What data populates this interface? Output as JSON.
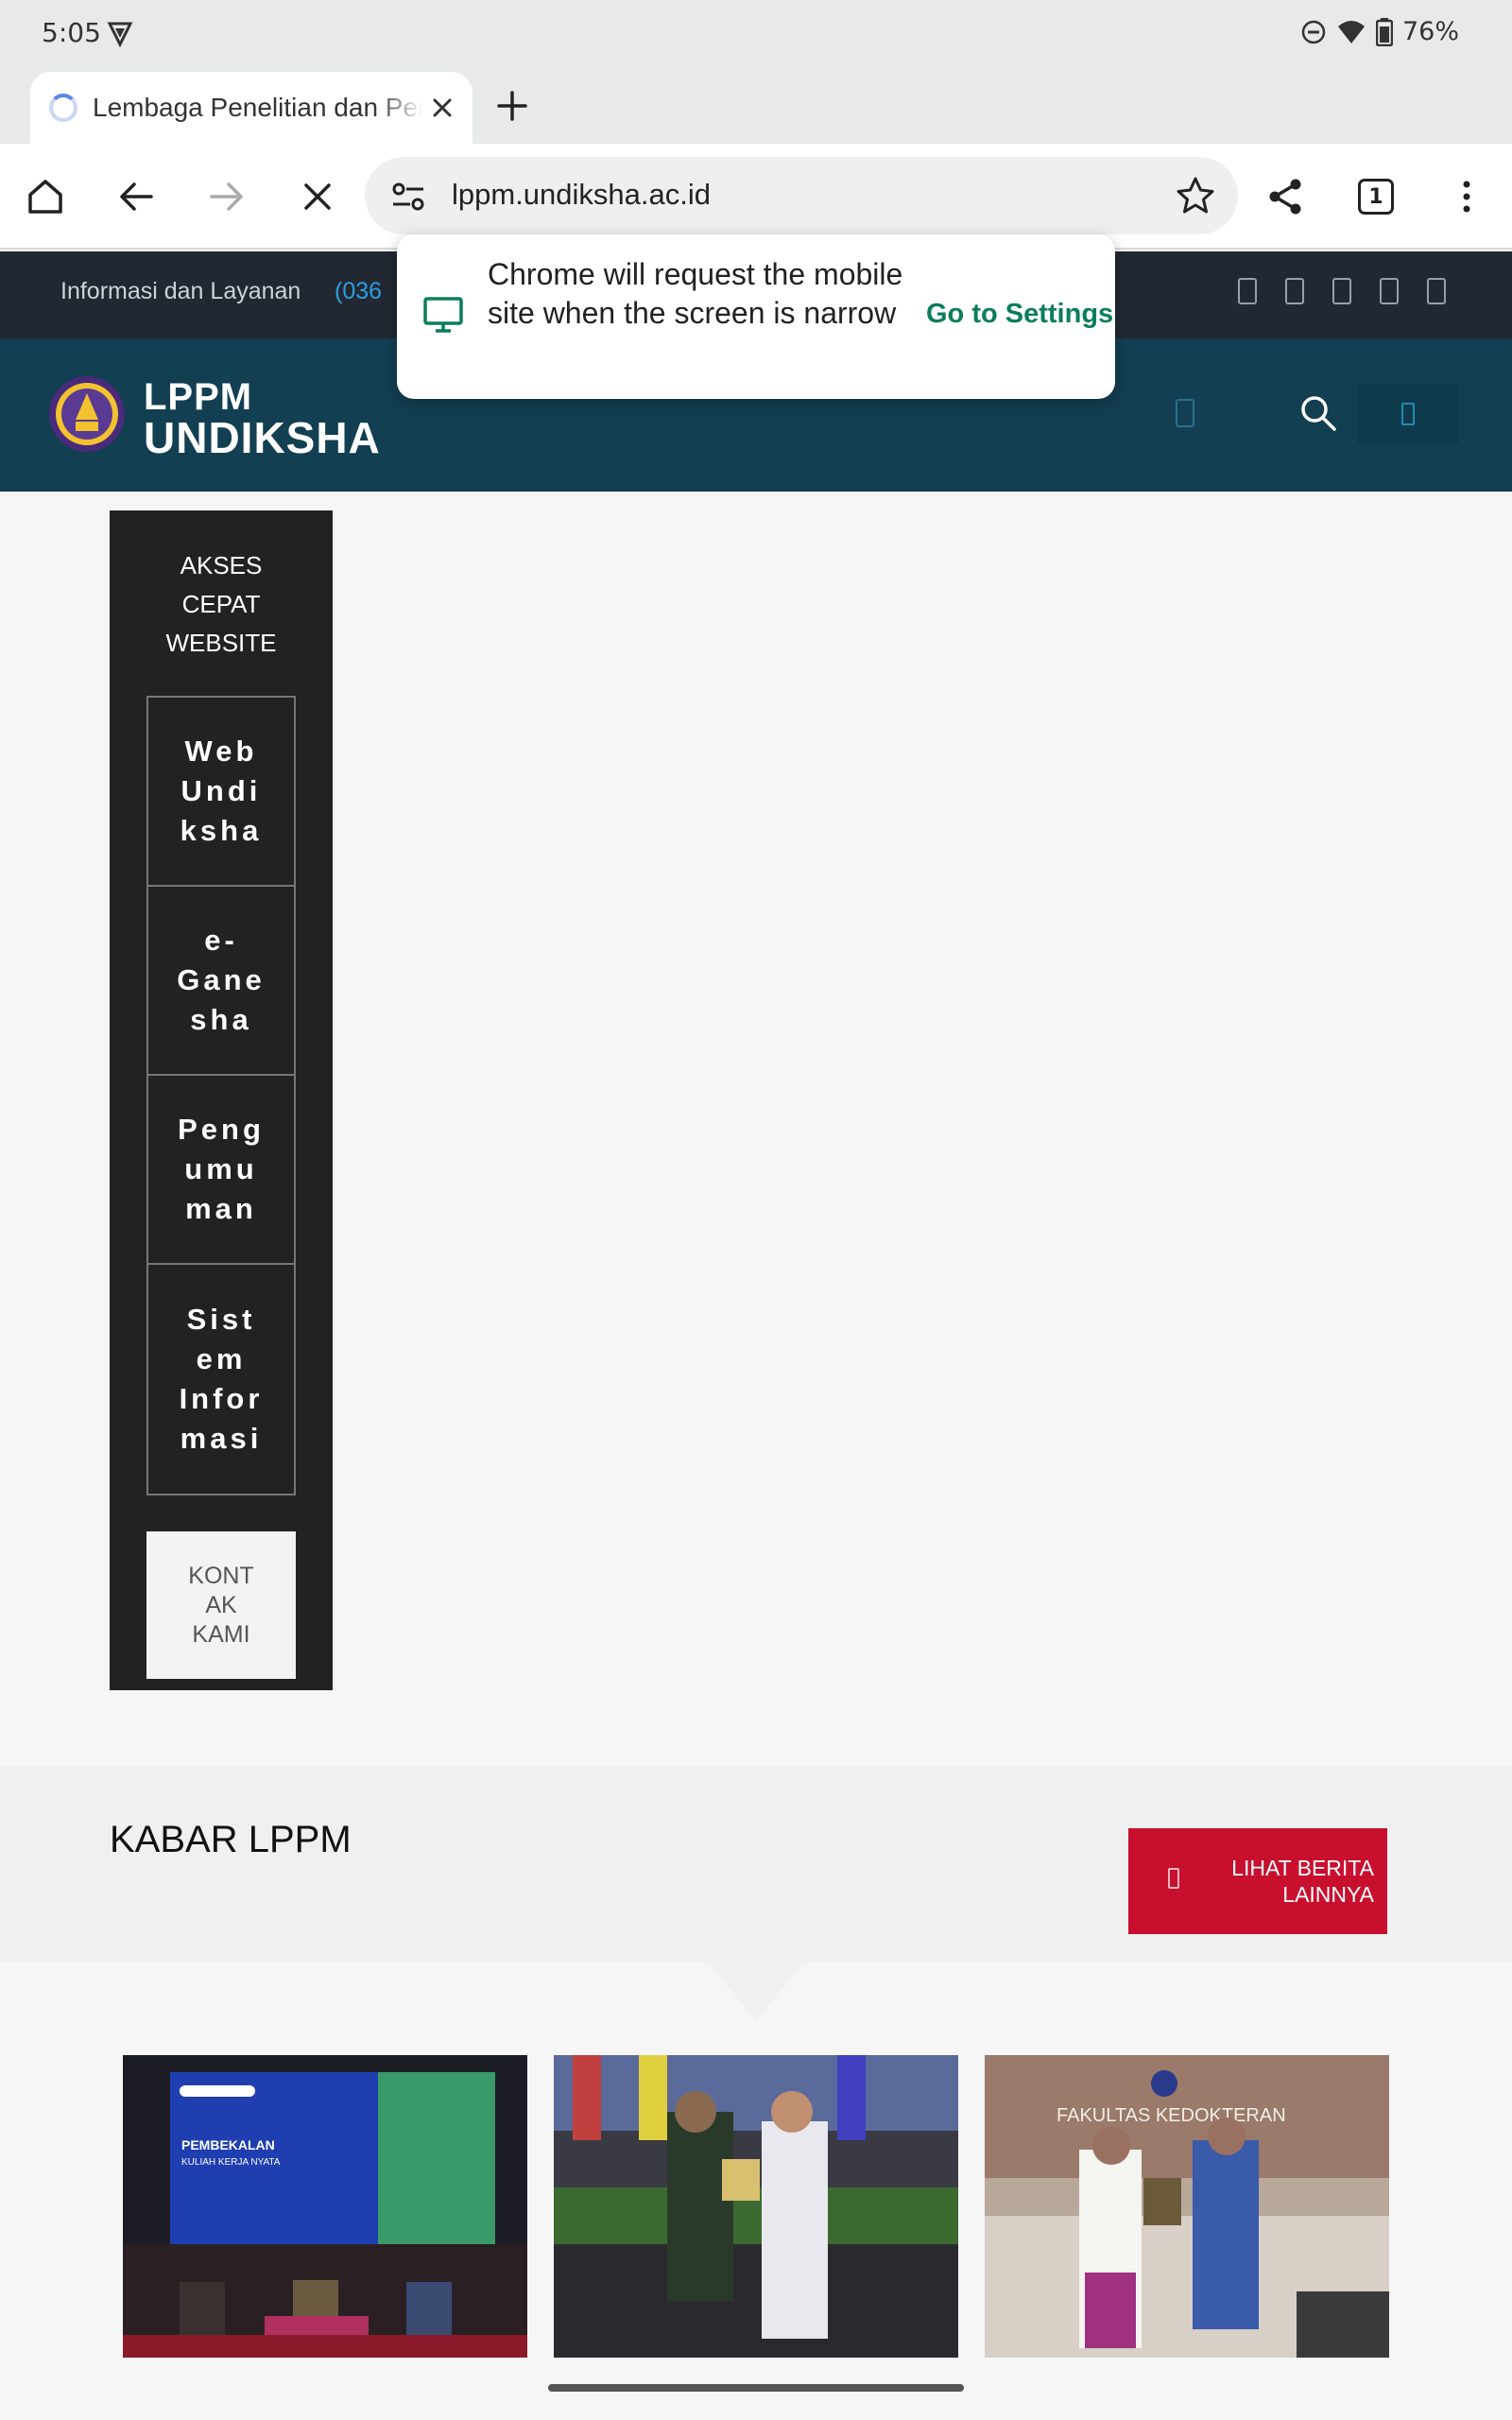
{
  "status_bar": {
    "time": "5:05",
    "battery": "76%"
  },
  "browser": {
    "tab_title": "Lembaga Penelitian dan Pengabdian kepada Masyarakat",
    "tab_count": "1",
    "url": "lppm.undiksha.ac.id"
  },
  "popup": {
    "message": "Chrome will request the mobile site when the screen is narrow",
    "action": "Go to Settings"
  },
  "site": {
    "info_text": "Informasi dan Layanan",
    "info_phone": "(036",
    "logo_line1": "LPPM",
    "logo_line2": "UNDIKSHA"
  },
  "quick_access": {
    "title": "AKSES\nCEPAT\nWEBSITE",
    "items": [
      {
        "label": "Web\nUndi\nksha"
      },
      {
        "label": "e-\nGane\nsha"
      },
      {
        "label": "Peng\numu\nman"
      },
      {
        "label": "Sist\nem\nInfor\nmasi"
      }
    ],
    "contact_label": "KONT\nAK\nKAMI"
  },
  "news": {
    "title": "KABAR LPPM",
    "more_label": "LIHAT BERITA\nLAINNYA",
    "cards": [
      {
        "image_text": "PEMBEKALAN",
        "image_subtext": "KULIAH KERJA NYATA"
      },
      {
        "image_text": ""
      },
      {
        "image_text": "FAKULTAS KEDOKTERAN"
      }
    ]
  },
  "colors": {
    "header_bg": "#123f52",
    "infobar_bg": "#222831",
    "sidebar_bg": "#222222",
    "accent_red": "#c8102e",
    "link_green": "#0b7d5b"
  }
}
